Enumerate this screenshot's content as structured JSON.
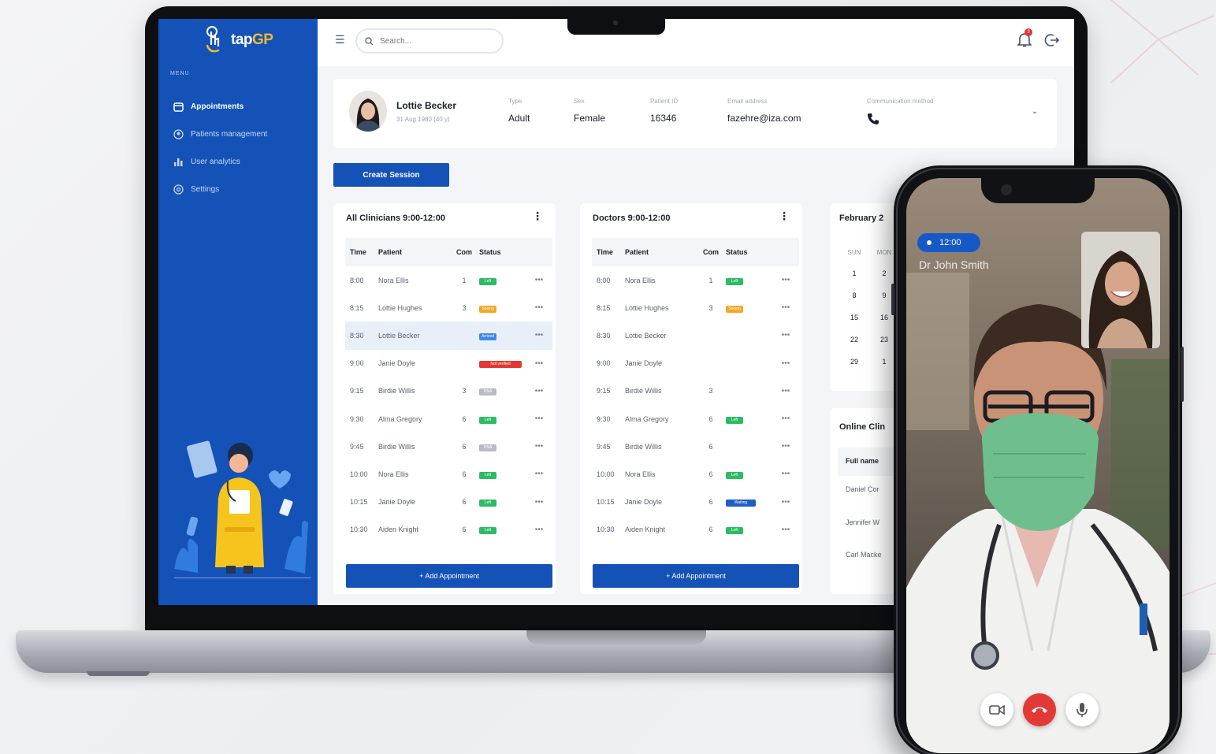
{
  "app": {
    "brand_prefix": "tap",
    "brand_suffix": "GP",
    "menu_label": "MENU"
  },
  "sidebar": {
    "items": [
      {
        "label": "Appointments",
        "icon": "calendar-icon",
        "active": true
      },
      {
        "label": "Patients management",
        "icon": "patients-icon",
        "active": false
      },
      {
        "label": "User analytics",
        "icon": "bar-chart-icon",
        "active": false
      },
      {
        "label": "Settings",
        "icon": "settings-icon",
        "active": false
      }
    ]
  },
  "topbar": {
    "search_placeholder": "Search...",
    "notification_count": "3"
  },
  "patient": {
    "name": "Lottie Becker",
    "dob": "31 Aug 1980 (40 y)",
    "type_label": "Type",
    "type_value": "Adult",
    "sex_label": "Sex",
    "sex_value": "Female",
    "id_label": "Patient ID",
    "id_value": "16346",
    "email_label": "Email address",
    "email_value": "fazehre@iza.com",
    "comm_label": "Communication method",
    "comm_icon": "phone-icon"
  },
  "actions": {
    "create_session": "Create Session",
    "add_appointment": "+ Add Appointment"
  },
  "table_headers": {
    "time": "Time",
    "patient": "Patient",
    "com": "Com",
    "status": "Status"
  },
  "panels": [
    {
      "title": "All Clinicians 9:00-12:00",
      "rows": [
        {
          "time": "8:00",
          "patient": "Nora Ellis",
          "com": "1",
          "status": "Left"
        },
        {
          "time": "8:15",
          "patient": "Lottie Hughes",
          "com": "3",
          "status": "Seeing"
        },
        {
          "time": "8:30",
          "patient": "Lottie Becker",
          "com": "",
          "status": "Arrived"
        },
        {
          "time": "9:00",
          "patient": "Janie Doyle",
          "com": "",
          "status": "Not verified"
        },
        {
          "time": "9:15",
          "patient": "Birdie Willis",
          "com": "3",
          "status": "DNA"
        },
        {
          "time": "9:30",
          "patient": "Alma Gregory",
          "com": "6",
          "status": "Left"
        },
        {
          "time": "9:45",
          "patient": "Birdie Willis",
          "com": "6",
          "status": "DNA"
        },
        {
          "time": "10:00",
          "patient": "Nora Ellis",
          "com": "6",
          "status": "Left"
        },
        {
          "time": "10:15",
          "patient": "Janie Doyle",
          "com": "6",
          "status": "Left"
        },
        {
          "time": "10:30",
          "patient": "Aiden Knight",
          "com": "6",
          "status": "Left"
        }
      ]
    },
    {
      "title": "Doctors 9:00-12:00",
      "rows": [
        {
          "time": "8:00",
          "patient": "Nora Ellis",
          "com": "1",
          "status": "Left"
        },
        {
          "time": "8:15",
          "patient": "Lottie Hughes",
          "com": "3",
          "status": "Seeing"
        },
        {
          "time": "8:30",
          "patient": "Lottie Becker",
          "com": "",
          "status": ""
        },
        {
          "time": "9:00",
          "patient": "Janie Doyle",
          "com": "",
          "status": ""
        },
        {
          "time": "9:15",
          "patient": "Birdie Willis",
          "com": "3",
          "status": ""
        },
        {
          "time": "9:30",
          "patient": "Alma Gregory",
          "com": "6",
          "status": "Left"
        },
        {
          "time": "9:45",
          "patient": "Birdie Willis",
          "com": "6",
          "status": ""
        },
        {
          "time": "10:00",
          "patient": "Nora Ellis",
          "com": "6",
          "status": "Left"
        },
        {
          "time": "10:15",
          "patient": "Janie Doyle",
          "com": "6",
          "status": "Waiting"
        },
        {
          "time": "10:30",
          "patient": "Aiden Knight",
          "com": "6",
          "status": "Left"
        }
      ]
    }
  ],
  "calendar": {
    "title": "February 2",
    "days": [
      "SUN",
      "MON"
    ],
    "dates": [
      "1",
      "2",
      "8",
      "9",
      "15",
      "16",
      "22",
      "23",
      "29",
      "1"
    ]
  },
  "online": {
    "title": "Online Clin",
    "header": "Full name",
    "rows": [
      "Daniel Cor",
      "Jennifer W",
      "Carl Macke"
    ]
  },
  "call": {
    "time": "12:00",
    "caller": "Dr John Smith"
  },
  "colors": {
    "primary": "#1452b8",
    "left": "#2dbb66",
    "seeing": "#f5a623",
    "arrived": "#3f86ea",
    "not_verified": "#e23a32",
    "dna": "#b7bcc6",
    "end_call": "#e13a36"
  }
}
